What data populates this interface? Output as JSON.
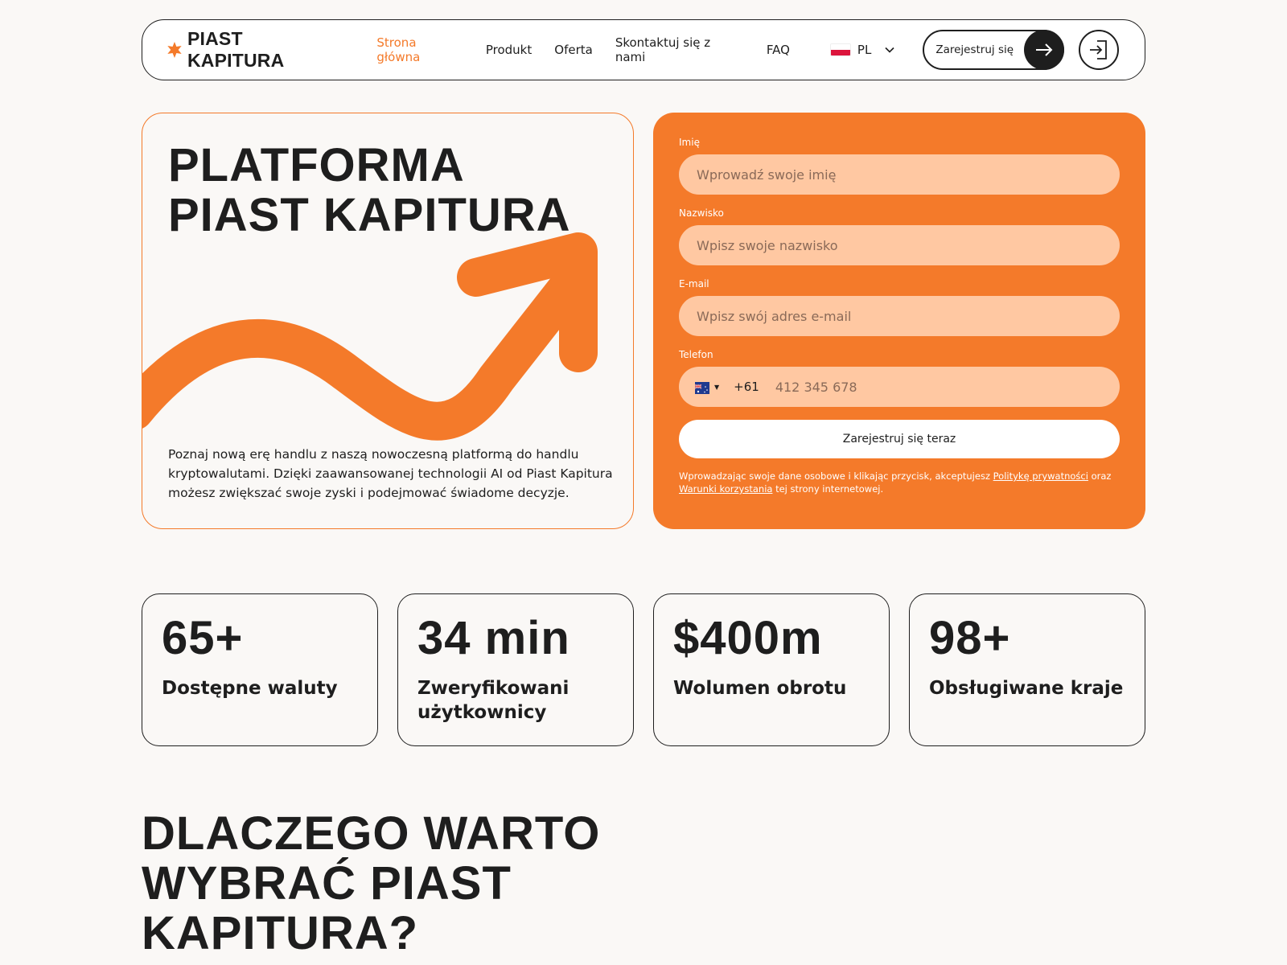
{
  "brand": {
    "name": "PIAST KAPITURA",
    "accent": "#f47a2a",
    "dark": "#1e1e1e"
  },
  "nav": {
    "items": [
      "Strona główna",
      "Produkt",
      "Oferta",
      "Skontaktuj się z nami",
      "FAQ"
    ],
    "active": "Strona główna"
  },
  "lang": {
    "code": "PL",
    "flag_icon": "poland-flag-icon"
  },
  "header": {
    "register_label": "Zarejestruj się",
    "register_icon": "arrow-right-icon",
    "login_icon": "login-icon"
  },
  "hero": {
    "title": "PLATFORMA\nPIAST KAPITURA",
    "description": "Poznaj nową erę handlu z naszą nowoczesną platformą do handlu kryptowalutami. Dzięki zaawansowanej technologii AI od Piast Kapitura możesz zwiększać swoje zyski i podejmować świadome decyzje."
  },
  "form": {
    "first_name": {
      "label": "Imię",
      "placeholder": "Wprowadź swoje imię"
    },
    "last_name": {
      "label": "Nazwisko",
      "placeholder": "Wpisz swoje nazwisko"
    },
    "email": {
      "label": "E-mail",
      "placeholder": "Wpisz swój adres e-mail"
    },
    "phone": {
      "label": "Telefon",
      "dial_code": "+61",
      "placeholder": "412 345 678",
      "flag_icon": "australia-flag-icon"
    },
    "submit_label": "Zarejestruj się teraz",
    "consent": {
      "before": "Wprowadzając swoje dane osobowe i klikając przycisk, akceptujesz ",
      "privacy_link": "Politykę prywatności",
      "middle": " oraz ",
      "terms_link": "Warunki korzystania",
      "after": " tej strony internetowej."
    }
  },
  "stats": [
    {
      "value": "65+",
      "label": "Dostępne waluty"
    },
    {
      "value": "34 min",
      "label": "Zweryfikowani użytkownicy"
    },
    {
      "value": "$400m",
      "label": "Wolumen obrotu"
    },
    {
      "value": "98+",
      "label": "Obsługiwane kraje"
    }
  ],
  "why": {
    "title": "DLACZEGO WARTO\nWYBRAĆ PIAST\nKAPITURA?"
  }
}
